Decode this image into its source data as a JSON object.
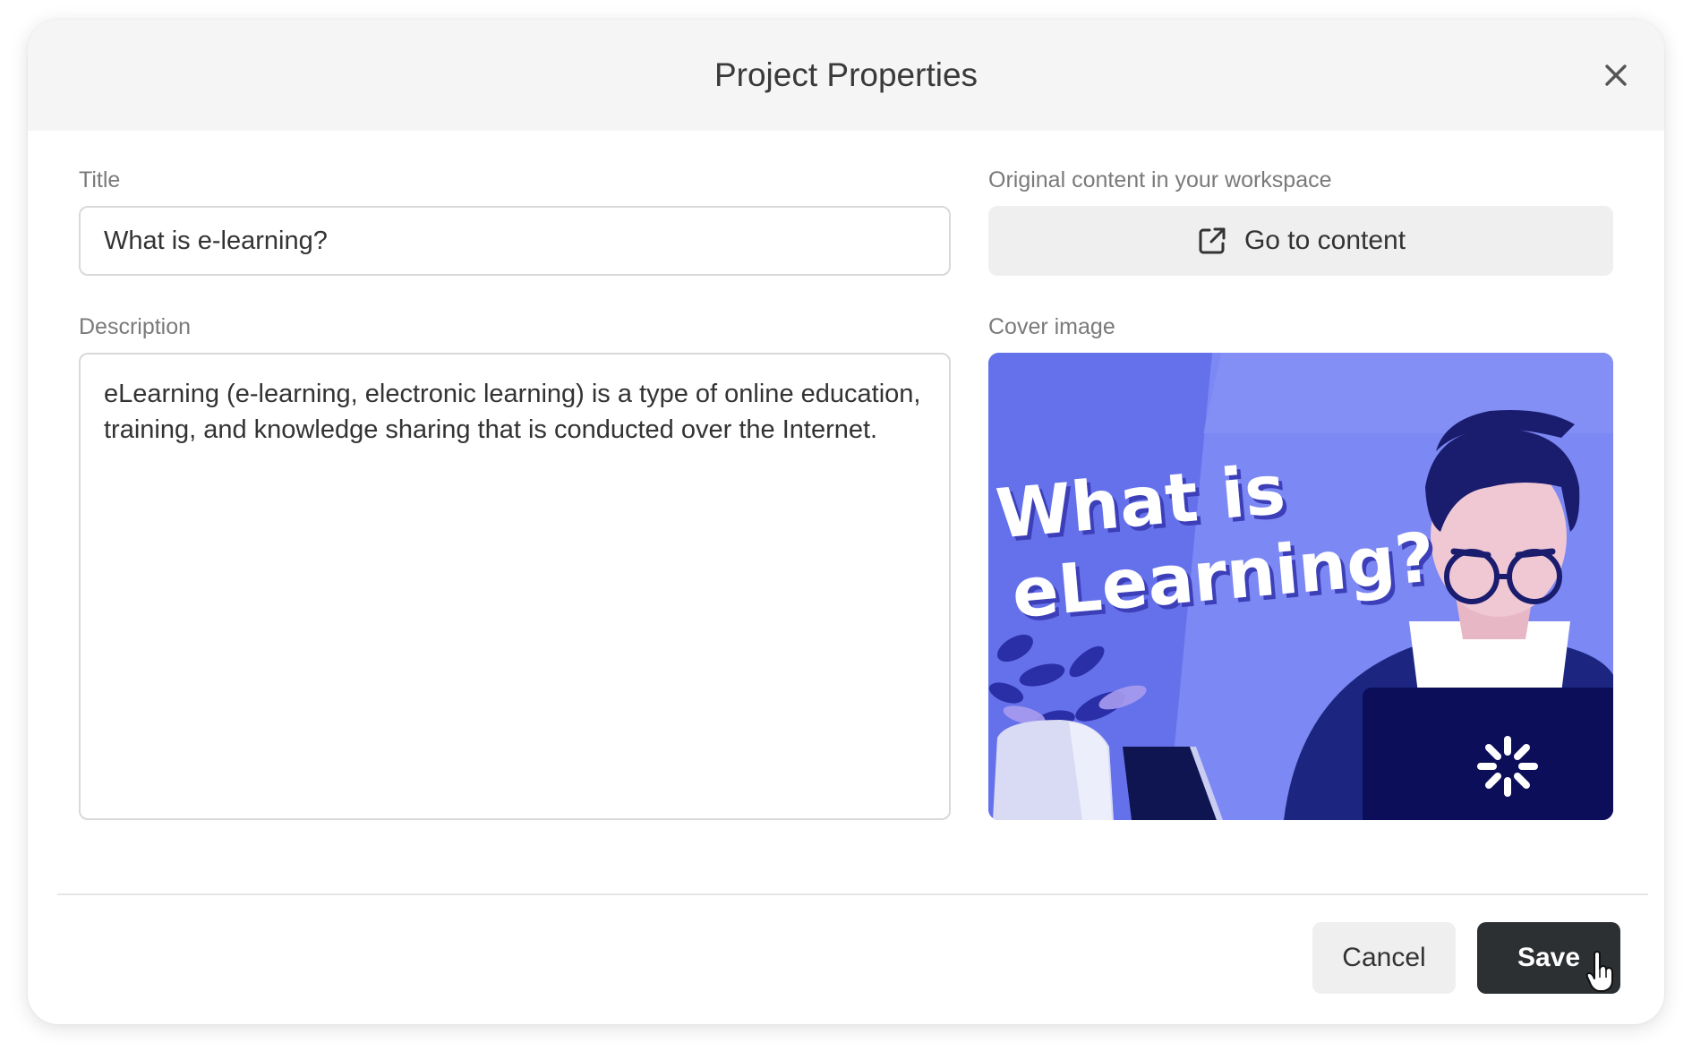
{
  "dialog": {
    "title": "Project Properties",
    "close_icon": "close-icon"
  },
  "form": {
    "title_label": "Title",
    "title_value": "What is e-learning?",
    "description_label": "Description",
    "description_value": "eLearning (e-learning, electronic learning) is a type of online education, training, and knowledge sharing that is conducted over the Internet.",
    "original_content_label": "Original content in your workspace",
    "go_to_content_label": "Go to content",
    "go_to_content_icon": "external-link-icon",
    "cover_image_label": "Cover image",
    "cover_image_text_line1": "What is",
    "cover_image_text_line2": "eLearning?"
  },
  "footer": {
    "cancel_label": "Cancel",
    "save_label": "Save"
  },
  "colors": {
    "header_bg": "#f5f5f5",
    "save_bg": "#2c3033",
    "cover_bg": "#6f7cf0",
    "cover_dark": "#1a1a6e"
  }
}
